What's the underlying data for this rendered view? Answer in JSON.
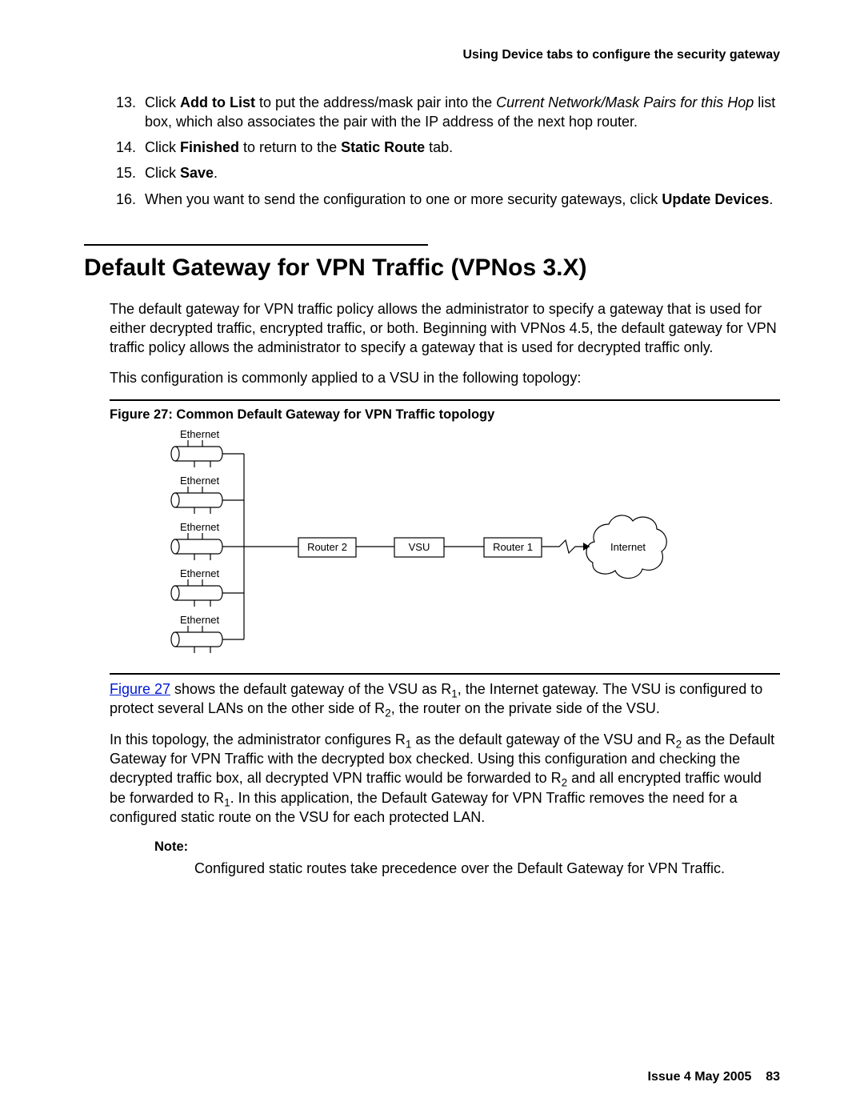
{
  "header": "Using Device tabs to configure the security gateway",
  "list_start": 13,
  "steps": [
    {
      "pre": "Click ",
      "b1": "Add to List",
      "mid": " to put the address/mask pair into the ",
      "i": "Current Network/Mask Pairs for this Hop",
      "post": " list box, which also associates the pair with the IP address of the next hop router."
    },
    {
      "pre": "Click ",
      "b1": "Finished",
      "mid": " to return to the ",
      "b2": "Static Route",
      "post": " tab."
    },
    {
      "pre": "Click ",
      "b1": "Save",
      "post": "."
    },
    {
      "pre": "When you want to send the configuration to one or more security gateways, click ",
      "b1": "Update Devices",
      "post": "."
    }
  ],
  "section_title": "Default Gateway for VPN Traffic (VPNos 3.X)",
  "para1": "The default gateway for VPN traffic policy allows the administrator to specify a gateway that is used for either decrypted traffic, encrypted traffic, or both. Beginning with VPNos 4.5, the default gateway for VPN traffic policy allows the administrator to specify a gateway that is used for decrypted traffic only.",
  "para2": "This configuration is commonly applied to a VSU in the following topology:",
  "figure_caption": "Figure 27: Common Default Gateway for VPN Traffic topology",
  "figure": {
    "ethernet": "Ethernet",
    "router2": "Router 2",
    "vsu": "VSU",
    "router1": "Router 1",
    "internet": "Internet"
  },
  "figref_text": "Figure 27",
  "post_fig_span1": " shows the default gateway of the VSU as R",
  "post_fig_sub1": "1",
  "post_fig_span2": ", the Internet gateway. The VSU is configured to protect several LANs on the other side of R",
  "post_fig_sub2": "2",
  "post_fig_span3": ", the router on the private side of the VSU.",
  "topo_span1": "In this topology, the administrator configures R",
  "topo_sub1": "1",
  "topo_span2": " as the default gateway of the VSU and R",
  "topo_sub2": "2",
  "topo_span3": " as the Default Gateway for VPN Traffic with the decrypted box checked. Using this configuration and checking the decrypted traffic box, all decrypted VPN traffic would be forwarded to R",
  "topo_sub3": "2",
  "topo_span4": " and all encrypted traffic would be forwarded to R",
  "topo_sub4": "1",
  "topo_span5": ". In this application, the Default Gateway for VPN Traffic removes the need for a configured static route on the VSU for each protected LAN.",
  "note_label": "Note:",
  "note_body": "Configured static routes take precedence over the Default Gateway for VPN Traffic.",
  "footer_issue": "Issue 4   May 2005",
  "footer_page": "83"
}
